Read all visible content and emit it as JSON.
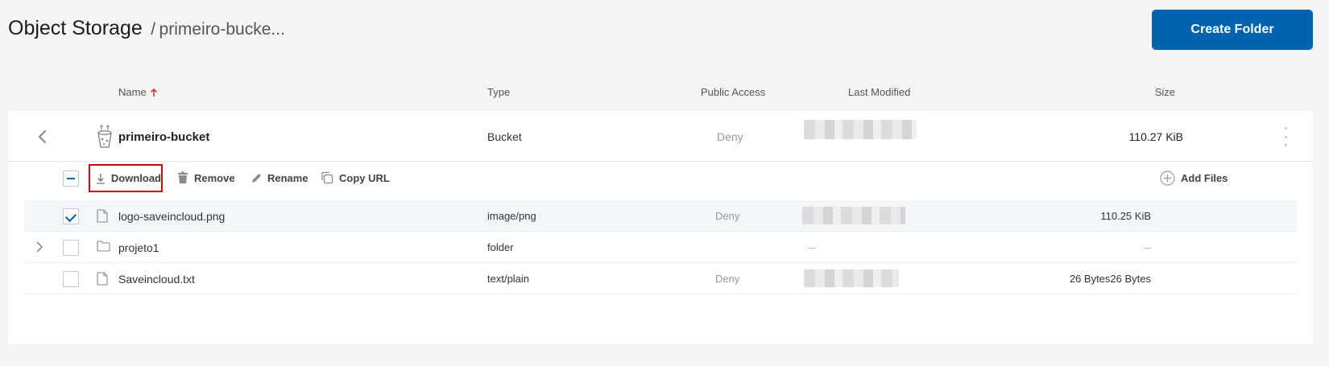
{
  "header": {
    "title": "Object Storage",
    "separator": "/",
    "subtitle": "primeiro-bucke...",
    "create_folder_label": "Create Folder"
  },
  "columns": {
    "name": "Name",
    "type": "Type",
    "public_access": "Public Access",
    "last_modified": "Last Modified",
    "size": "Size"
  },
  "sort": {
    "column": "Name",
    "direction": "ascending",
    "indicator_color": "#d21f1f"
  },
  "bucket": {
    "name": "primeiro-bucket",
    "type": "Bucket",
    "public_access": "Deny",
    "size": "110.27 KiB"
  },
  "toolbar": {
    "download_label": "Download",
    "remove_label": "Remove",
    "rename_label": "Rename",
    "copy_url_label": "Copy URL",
    "add_files_label": "Add Files"
  },
  "files": [
    {
      "name": "logo-saveincloud.png",
      "type": "image/png",
      "public_access": "Deny",
      "size": "110.25 KiB",
      "checked": true,
      "icon": "file-icon"
    },
    {
      "name": "projeto1",
      "type": "folder",
      "last_modified": "--",
      "size": "--",
      "checked": false,
      "icon": "folder-icon"
    },
    {
      "name": "Saveincloud.txt",
      "type": "text/plain",
      "public_access": "Deny",
      "size": "26 Bytes26 Bytes",
      "checked": false,
      "icon": "file-icon"
    }
  ],
  "colors": {
    "accent": "#0063b0",
    "highlight_border": "#d40000",
    "background": "#f4f4f4",
    "panel": "#ffffff",
    "selected_row": "#f3f7fc"
  }
}
